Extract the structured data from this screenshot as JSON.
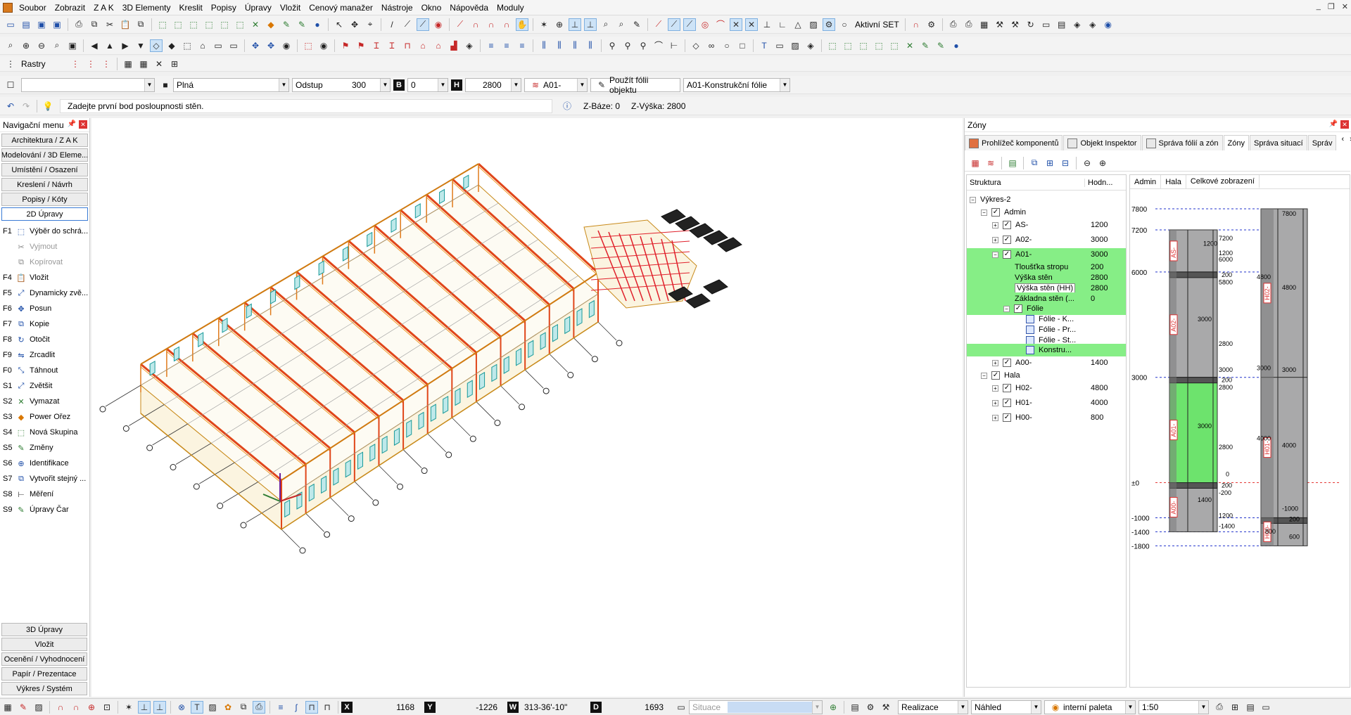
{
  "menu": [
    "Soubor",
    "Zobrazit",
    "Z A K",
    "3D Elementy",
    "Kreslit",
    "Popisy",
    "Úpravy",
    "Vložit",
    "Cenový manažer",
    "Nástroje",
    "Okno",
    "Nápověda",
    "Moduly"
  ],
  "toolbar1": {
    "active_set_label": "Aktivní SET"
  },
  "toolbar3": {
    "rastry_label": "Rastry"
  },
  "props": {
    "linetype": "Plná",
    "offset_label": "Odstup",
    "offset_value": "300",
    "b_label": "B",
    "b_value": "0",
    "h_label": "H",
    "h_value": "2800",
    "layer": "A01-",
    "use_layer_btn": "Použít fólii objektu",
    "layer_name": "A01-Konstrukční fólie"
  },
  "prompt": {
    "text": "Zadejte první bod posloupnosti stěn.",
    "z_base": "Z-Báze: 0",
    "z_height": "Z-Výška: 2800"
  },
  "nav": {
    "title": "Navigační menu",
    "sections": [
      "Architektura / Z A K",
      "Modelování / 3D Eleme...",
      "Umístění / Osazení",
      "Kreslení / Návrh",
      "Popisy / Kóty",
      "2D Úpravy"
    ],
    "commands": [
      {
        "key": "F1",
        "label": "Výběr do schrá...",
        "disabled": false
      },
      {
        "key": "",
        "label": "Vyjmout",
        "disabled": true
      },
      {
        "key": "",
        "label": "Kopírovat",
        "disabled": true
      },
      {
        "key": "F4",
        "label": "Vložit",
        "disabled": false
      },
      {
        "key": "F5",
        "label": "Dynamicky zvě...",
        "disabled": false
      },
      {
        "key": "F6",
        "label": "Posun",
        "disabled": false
      },
      {
        "key": "F7",
        "label": "Kopie",
        "disabled": false
      },
      {
        "key": "F8",
        "label": "Otočit",
        "disabled": false
      },
      {
        "key": "F9",
        "label": "Zrcadlit",
        "disabled": false
      },
      {
        "key": "F0",
        "label": "Táhnout",
        "disabled": false
      },
      {
        "key": "S1",
        "label": "Zvětšit",
        "disabled": false
      },
      {
        "key": "S2",
        "label": "Vymazat",
        "disabled": false
      },
      {
        "key": "S3",
        "label": "Power Ořez",
        "disabled": false
      },
      {
        "key": "S4",
        "label": "Nová Skupina",
        "disabled": false
      },
      {
        "key": "S5",
        "label": "Změny",
        "disabled": false
      },
      {
        "key": "S6",
        "label": "Identifikace",
        "disabled": false
      },
      {
        "key": "S7",
        "label": "Vytvořit stejný ...",
        "disabled": false
      },
      {
        "key": "S8",
        "label": "Měření",
        "disabled": false
      },
      {
        "key": "S9",
        "label": "Úpravy Čar",
        "disabled": false
      }
    ],
    "bottom": [
      "3D Úpravy",
      "Vložit",
      "Ocenění / Vyhodnocení",
      "Papír / Prezentace",
      "Výkres / Systém"
    ]
  },
  "zones": {
    "title": "Zóny",
    "tabs": [
      "Prohlížeč komponentů",
      "Objekt Inspektor",
      "Správa fólií a zón",
      "Zóny",
      "Správa situací",
      "Správ"
    ],
    "tree_header": [
      "Struktura",
      "Hodn..."
    ],
    "tree": [
      {
        "label": "Výkres-2",
        "value": ""
      },
      {
        "label": "Admin",
        "value": ""
      },
      {
        "label": "AS-",
        "value": "1200"
      },
      {
        "label": "A02-",
        "value": "3000"
      },
      {
        "label": "A01-",
        "value": "3000"
      },
      {
        "label": "Tloušťka stropu",
        "value": "200"
      },
      {
        "label": "Výška stěn",
        "value": "2800"
      },
      {
        "label": "Výška stěn (HH)",
        "value": "2800"
      },
      {
        "label": "Základna stěn (...",
        "value": "0"
      },
      {
        "label": "Fólie",
        "value": ""
      },
      {
        "label": "Fólie - K...",
        "value": ""
      },
      {
        "label": "Fólie - Pr...",
        "value": ""
      },
      {
        "label": "Fólie - St...",
        "value": ""
      },
      {
        "label": "Konstru...",
        "value": ""
      },
      {
        "label": "A00-",
        "value": "1400"
      },
      {
        "label": "Hala",
        "value": ""
      },
      {
        "label": "H02-",
        "value": "4800"
      },
      {
        "label": "H01-",
        "value": "4000"
      },
      {
        "label": "H00-",
        "value": "800"
      }
    ],
    "elev_tabs": [
      "Admin",
      "Hala",
      "Celkové zobrazení"
    ],
    "levels": [
      "7800",
      "7200",
      "6000",
      "3000",
      "±0",
      "-1000",
      "-1400",
      "-1800"
    ],
    "colA_labels": [
      "AS-",
      "A02-",
      "A01-",
      "A00-"
    ],
    "colH_labels": [
      "H02-",
      "H01-",
      "H00-"
    ],
    "dims": {
      "as": [
        "7200",
        "1200",
        "1200",
        "6000"
      ],
      "a02": [
        "200",
        "5800",
        "3000",
        "2800",
        "3000"
      ],
      "a01": [
        "200",
        "2800",
        "3000",
        "2800",
        "0"
      ],
      "a00": [
        "200",
        "-200",
        "1400",
        "1200",
        "-1400"
      ],
      "h02": [
        "7800",
        "4800",
        "4800",
        "3000"
      ],
      "h01": [
        "3000",
        "4000",
        "4000"
      ],
      "h00": [
        "-1000",
        "200",
        "800",
        "600"
      ]
    }
  },
  "status": {
    "x_label": "X",
    "x_value": "1168",
    "y_label": "Y",
    "y_value": "-1226",
    "w_label": "W",
    "w_value": "313-36'-10\"",
    "d_label": "D",
    "d_value": "1693",
    "situation_placeholder": "Situace",
    "mode": "Realizace",
    "view": "Náhled",
    "palette": "interní paleta",
    "scale": "1:50"
  }
}
